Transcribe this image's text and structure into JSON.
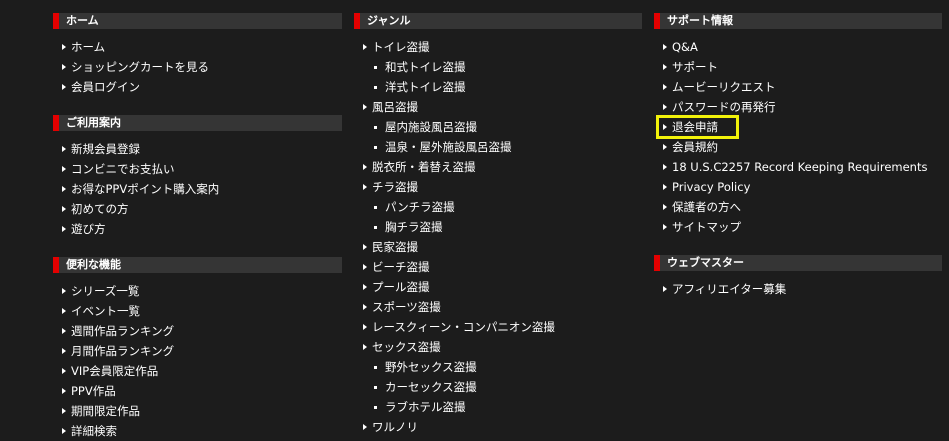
{
  "colors": {
    "background": "#1c1c1c",
    "header_bg": "#353535",
    "header_accent": "#e30000",
    "highlight": "#f2f20a",
    "text": "#ffffff"
  },
  "icons": {
    "arrow": "caret-right-icon",
    "bullet": "dot-icon"
  },
  "left": {
    "home": {
      "title": "ホーム",
      "items": [
        "ホーム",
        "ショッピングカートを見る",
        "会員ログイン"
      ]
    },
    "guide": {
      "title": "ご利用案内",
      "items": [
        "新規会員登録",
        "コンビニでお支払い",
        "お得なPPVポイント購入案内",
        "初めての方",
        "遊び方"
      ]
    },
    "features": {
      "title": "便利な機能",
      "items": [
        "シリーズ一覧",
        "イベント一覧",
        "週間作品ランキング",
        "月間作品ランキング",
        "VIP会員限定作品",
        "PPV作品",
        "期間限定作品",
        "詳細検索"
      ]
    }
  },
  "mid": {
    "genre": {
      "title": "ジャンル",
      "items": [
        {
          "label": "トイレ盗撮",
          "level": "main"
        },
        {
          "label": "和式トイレ盗撮",
          "level": "sub"
        },
        {
          "label": "洋式トイレ盗撮",
          "level": "sub"
        },
        {
          "label": "風呂盗撮",
          "level": "main"
        },
        {
          "label": "屋内施設風呂盗撮",
          "level": "sub"
        },
        {
          "label": "温泉・屋外施設風呂盗撮",
          "level": "sub"
        },
        {
          "label": "脱衣所・着替え盗撮",
          "level": "main"
        },
        {
          "label": "チラ盗撮",
          "level": "main"
        },
        {
          "label": "パンチラ盗撮",
          "level": "sub"
        },
        {
          "label": "胸チラ盗撮",
          "level": "sub"
        },
        {
          "label": "民家盗撮",
          "level": "main"
        },
        {
          "label": "ビーチ盗撮",
          "level": "main"
        },
        {
          "label": "プール盗撮",
          "level": "main"
        },
        {
          "label": "スポーツ盗撮",
          "level": "main"
        },
        {
          "label": "レースクィーン・コンパニオン盗撮",
          "level": "main"
        },
        {
          "label": "セックス盗撮",
          "level": "main"
        },
        {
          "label": "野外セックス盗撮",
          "level": "sub"
        },
        {
          "label": "カーセックス盗撮",
          "level": "sub"
        },
        {
          "label": "ラブホテル盗撮",
          "level": "sub"
        },
        {
          "label": "ワルノリ",
          "level": "main"
        }
      ]
    }
  },
  "right": {
    "support": {
      "title": "サポート情報",
      "items": [
        "Q&A",
        "サポート",
        "ムービーリクエスト",
        "パスワードの再発行",
        "退会申請",
        "会員規約",
        "18 U.S.C2257 Record Keeping Requirements",
        "Privacy Policy",
        "保護者の方へ",
        "サイトマップ"
      ]
    },
    "webmaster": {
      "title": "ウェブマスター",
      "items": [
        "アフィリエイター募集"
      ]
    }
  }
}
